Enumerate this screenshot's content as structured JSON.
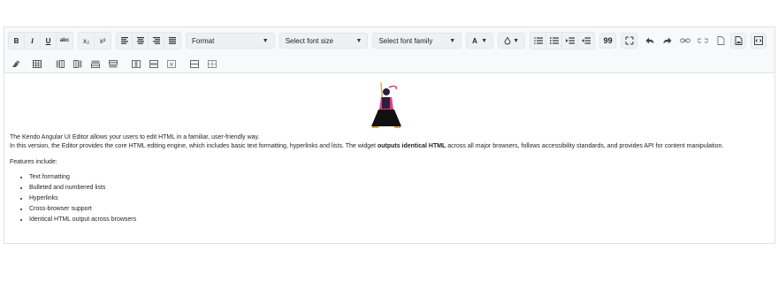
{
  "toolbar": {
    "format_label": "Format",
    "font_size_placeholder": "Select font size",
    "font_family_placeholder": "Select font family",
    "bold": "B",
    "italic": "I",
    "underline": "U",
    "strike": "abc",
    "subscript": "x₂",
    "superscript": "x²",
    "font_color": "A",
    "quote": "99"
  },
  "content": {
    "intro_line": "The Kendo Angular UI Editor allows your users to edit HTML in a familiar, user-friendly way.",
    "para_part1": "In this version, the Editor provides the core HTML editing engine, which includes basic text formatting, hyperlinks and lists. The widget ",
    "para_bold": "outputs identical HTML",
    "para_part2": " across all major browsers, follows accessibility standards, and provides API for content manipulation.",
    "features_heading": "Features include:",
    "features": [
      "Text formatting",
      "Bulleted and numbered lists",
      "Hyperlinks",
      "Cross-browser support",
      "Identical HTML output across browsers"
    ]
  }
}
